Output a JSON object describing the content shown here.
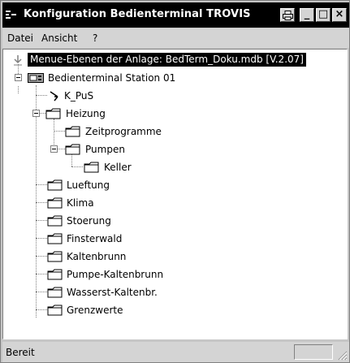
{
  "window": {
    "title": "Konfiguration Bedienterminal TROVIS",
    "minimize_glyph": "_",
    "maximize_glyph": "□",
    "close_glyph": "×"
  },
  "menu": {
    "items": [
      {
        "label": "Datei"
      },
      {
        "label": "Ansicht"
      },
      {
        "label": "?"
      }
    ]
  },
  "tree": {
    "root_label": "Menue-Ebenen der Anlage: BedTerm_Doku.mdb [V.2.07]",
    "nodes": [
      {
        "label": "Bedienterminal Station 01",
        "icon": "terminal-icon",
        "expanded": true
      },
      {
        "label": "K_PuS",
        "icon": "link-icon"
      },
      {
        "label": "Heizung",
        "icon": "folder-icon",
        "expanded": true
      },
      {
        "label": "Zeitprogramme",
        "icon": "folder-icon"
      },
      {
        "label": "Pumpen",
        "icon": "folder-icon",
        "expanded": true
      },
      {
        "label": "Keller",
        "icon": "folder-icon"
      },
      {
        "label": "Lueftung",
        "icon": "folder-icon"
      },
      {
        "label": "Klima",
        "icon": "folder-icon"
      },
      {
        "label": "Stoerung",
        "icon": "folder-icon"
      },
      {
        "label": "Finsterwald",
        "icon": "folder-icon"
      },
      {
        "label": "Kaltenbrunn",
        "icon": "folder-icon"
      },
      {
        "label": "Pumpe-Kaltenbrunn",
        "icon": "folder-icon"
      },
      {
        "label": "Wasserst-Kaltenbr.",
        "icon": "folder-icon"
      },
      {
        "label": "Grenzwerte",
        "icon": "folder-icon"
      }
    ]
  },
  "status": {
    "text": "Bereit"
  }
}
